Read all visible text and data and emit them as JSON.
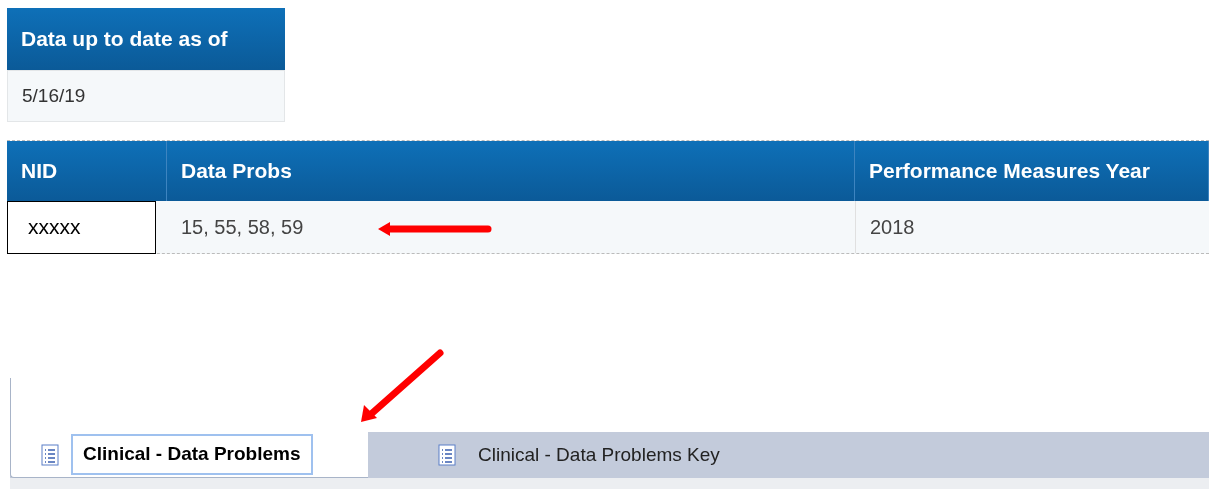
{
  "status_table": {
    "column": "Data up to date as of",
    "value": "5/16/19"
  },
  "problems_table": {
    "columns": [
      "NID",
      "Data Probs",
      "Performance Measures Year"
    ],
    "rows": [
      {
        "nid": "xxxxx",
        "data_probs": "15, 55, 58, 59",
        "year": "2018"
      }
    ]
  },
  "tabs": [
    {
      "label": "Clinical - Data Problems",
      "selected": true
    },
    {
      "label": "Clinical - Data Problems Key",
      "selected": false
    }
  ]
}
